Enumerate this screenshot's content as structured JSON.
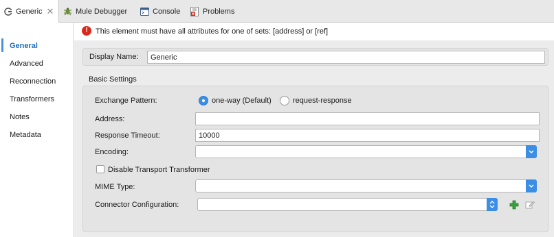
{
  "tabs": [
    {
      "label": "Generic",
      "icon": "connector-icon",
      "active": true
    },
    {
      "label": "Mule Debugger",
      "icon": "bug-icon"
    },
    {
      "label": "Console",
      "icon": "console-icon"
    },
    {
      "label": "Problems",
      "icon": "problems-icon"
    }
  ],
  "sidebar": {
    "items": [
      {
        "label": "General",
        "active": true
      },
      {
        "label": "Advanced"
      },
      {
        "label": "Reconnection"
      },
      {
        "label": "Transformers"
      },
      {
        "label": "Notes"
      },
      {
        "label": "Metadata"
      }
    ]
  },
  "error": {
    "message": "This element must have all attributes for one of sets: [address] or [ref]"
  },
  "display_name": {
    "label": "Display Name:",
    "value": "Generic"
  },
  "basic_settings": {
    "title": "Basic Settings",
    "exchange_pattern": {
      "label": "Exchange Pattern:",
      "options": [
        "one-way (Default)",
        "request-response"
      ],
      "selected": "one-way (Default)"
    },
    "address": {
      "label": "Address:",
      "value": ""
    },
    "response_timeout": {
      "label": "Response Timeout:",
      "value": "10000"
    },
    "encoding": {
      "label": "Encoding:",
      "value": ""
    },
    "disable_transport_transformer": {
      "label": "Disable Transport Transformer",
      "checked": false
    },
    "mime_type": {
      "label": "MIME Type:",
      "value": ""
    },
    "connector_configuration": {
      "label": "Connector Configuration:",
      "value": ""
    }
  },
  "colors": {
    "accent": "#3a8ee6",
    "error": "#d9291c",
    "active_nav": "#1f6fb8",
    "add_green": "#3aa13a"
  }
}
